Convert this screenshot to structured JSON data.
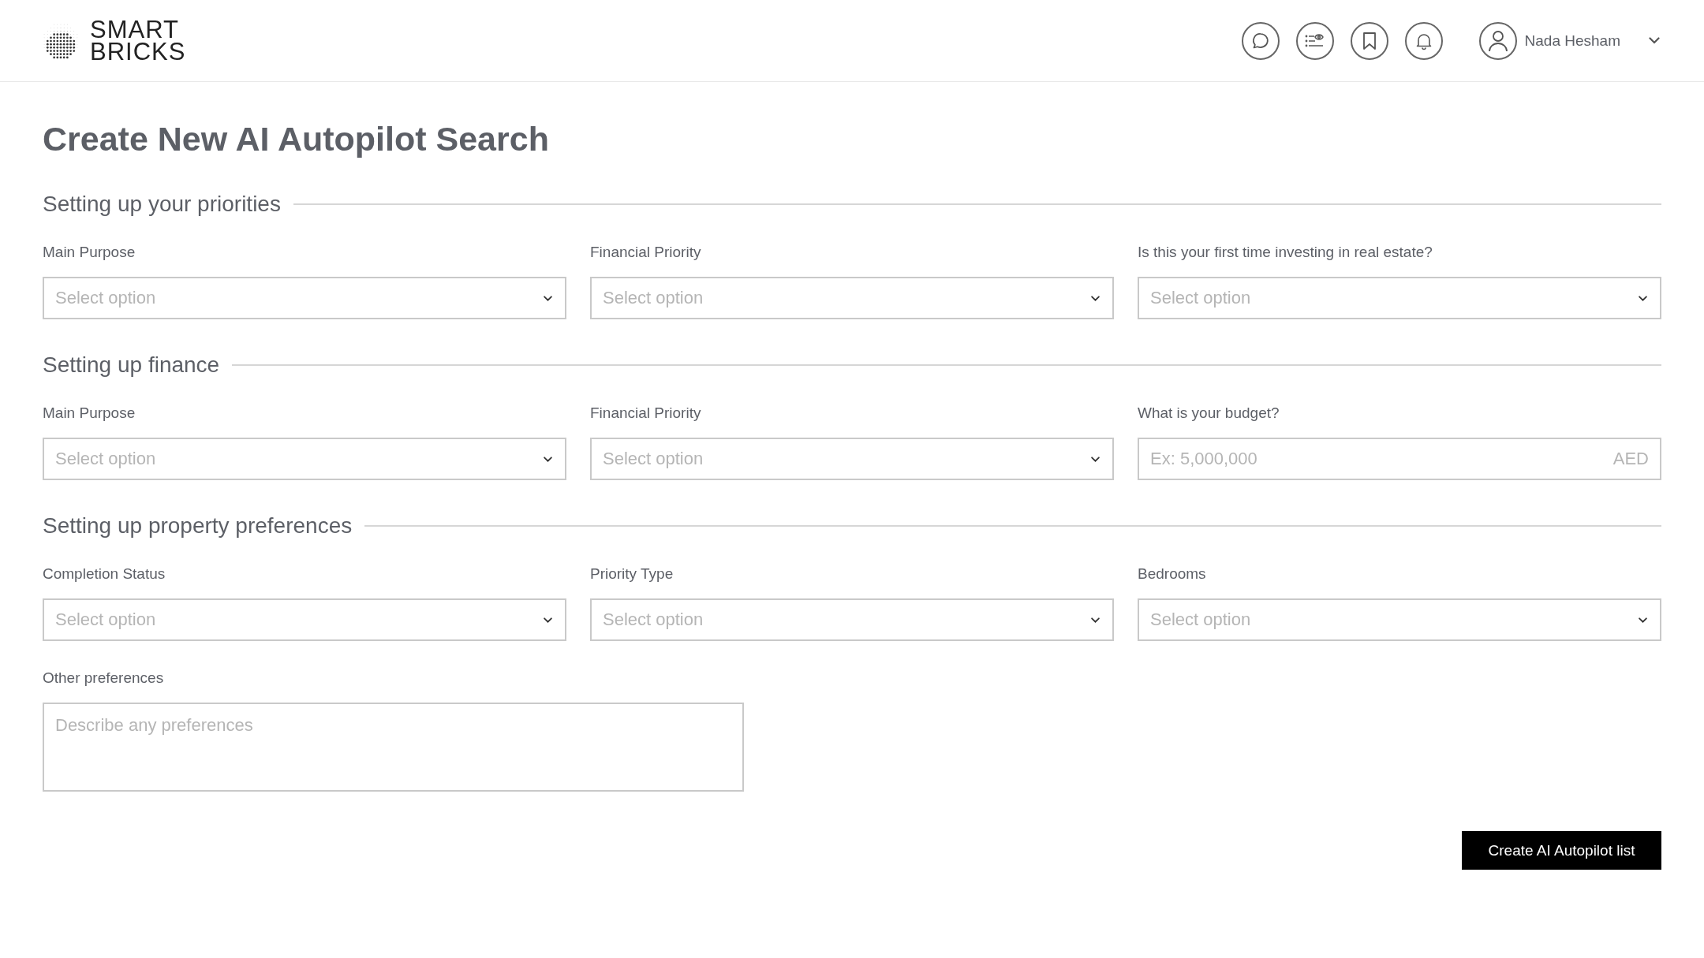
{
  "header": {
    "logo_lines": [
      "SMART",
      "BRICKS"
    ],
    "user_name": "Nada Hesham"
  },
  "title": "Create New AI Autopilot Search",
  "sections": [
    {
      "title": "Setting up your priorities",
      "fields": [
        {
          "kind": "select",
          "label": "Main Purpose",
          "placeholder": "Select option"
        },
        {
          "kind": "select",
          "label": "Financial Priority",
          "placeholder": "Select option"
        },
        {
          "kind": "select",
          "label": "Is this your first time investing in real estate?",
          "placeholder": "Select option"
        }
      ]
    },
    {
      "title": "Setting up finance",
      "fields": [
        {
          "kind": "select",
          "label": "Main Purpose",
          "placeholder": "Select option"
        },
        {
          "kind": "select",
          "label": "Financial Priority",
          "placeholder": "Select option"
        },
        {
          "kind": "amount",
          "label": "What is your budget?",
          "placeholder": "Ex: 5,000,000",
          "suffix": "AED"
        }
      ]
    },
    {
      "title": "Setting up property preferences",
      "fields": [
        {
          "kind": "select",
          "label": "Completion Status",
          "placeholder": "Select option"
        },
        {
          "kind": "select",
          "label": "Priority Type",
          "placeholder": "Select option"
        },
        {
          "kind": "select",
          "label": "Bedrooms",
          "placeholder": "Select option"
        }
      ]
    }
  ],
  "other": {
    "label": "Other preferences",
    "placeholder": "Describe any preferences"
  },
  "submit": "Create AI Autopilot list"
}
